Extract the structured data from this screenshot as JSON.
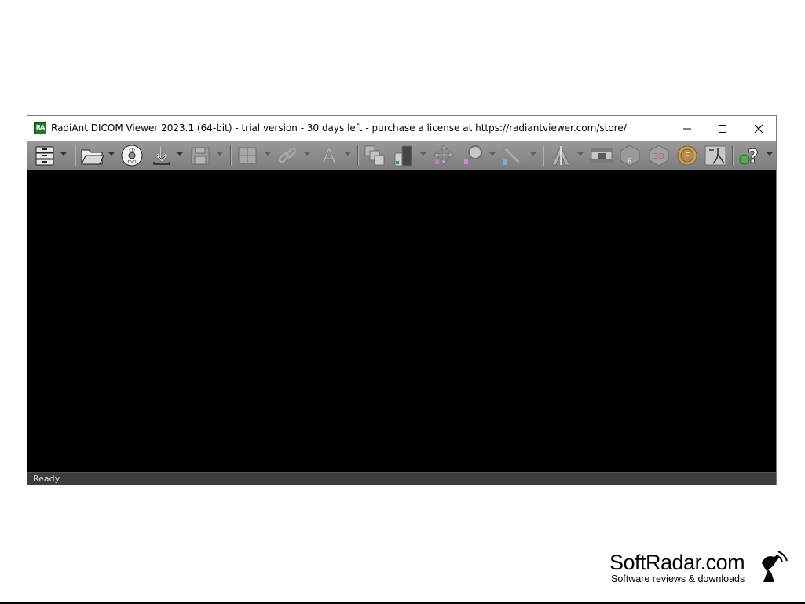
{
  "window": {
    "title": "RadiAnt DICOM Viewer 2023.1 (64-bit) - trial version - 30 days left - purchase a license at https://radiantviewer.com/store/",
    "logo_text": "RA"
  },
  "toolbar": {
    "buttons": [
      {
        "name": "database-icon"
      },
      {
        "name": "open-folder-icon"
      },
      {
        "name": "cd-dvd-icon",
        "label": "CD DVD"
      },
      {
        "name": "download-icon"
      },
      {
        "name": "save-icon"
      },
      {
        "name": "layout-grid-icon"
      },
      {
        "name": "link-icon"
      },
      {
        "name": "text-annotation-icon",
        "label": "A"
      },
      {
        "name": "series-stack-icon"
      },
      {
        "name": "window-level-icon"
      },
      {
        "name": "pan-icon"
      },
      {
        "name": "zoom-icon"
      },
      {
        "name": "measure-icon"
      },
      {
        "name": "reference-lines-icon"
      },
      {
        "name": "cine-film-icon"
      },
      {
        "name": "mpr-icon",
        "label": "R"
      },
      {
        "name": "3d-icon",
        "label": "3D"
      },
      {
        "name": "fusion-icon",
        "label": "F"
      },
      {
        "name": "vessel-icon"
      },
      {
        "name": "help-icon",
        "label": "?"
      }
    ]
  },
  "status": {
    "text": "Ready"
  },
  "watermark": {
    "name": "SoftRadar.com",
    "tagline": "Software reviews & downloads"
  },
  "colors": {
    "toolbar_bg": "#8a8a8a",
    "viewport_bg": "#000000",
    "statusbar_bg": "#3c3c3c",
    "logo_green": "#1f7a1f"
  }
}
